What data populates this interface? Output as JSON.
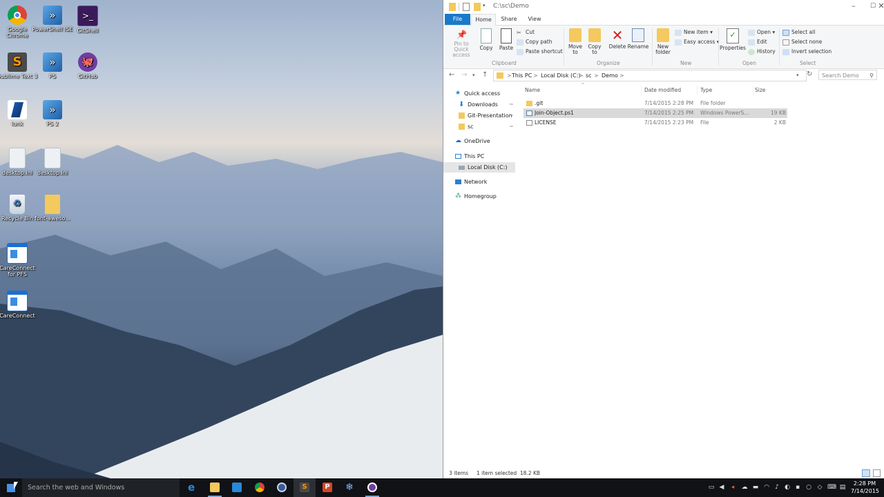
{
  "desktop": {
    "icons": [
      {
        "label": "Google Chrome",
        "icon": "chrome-icon"
      },
      {
        "label": "PowerShell ISE",
        "icon": "powershell-ise-icon"
      },
      {
        "label": "GitShell",
        "icon": "gitshell-icon"
      },
      {
        "label": "Sublime Text 3",
        "icon": "sublime-text-icon"
      },
      {
        "label": "PS",
        "icon": "powershell-icon"
      },
      {
        "label": "GitHub",
        "icon": "github-icon"
      },
      {
        "label": "lunk",
        "icon": "link-icon"
      },
      {
        "label": "PS 2",
        "icon": "powershell-icon"
      },
      {
        "label": "desktop.ini",
        "icon": "ini-file-icon"
      },
      {
        "label": "desktop.ini",
        "icon": "ini-file-icon"
      },
      {
        "label": "Recycle Bin",
        "icon": "recycle-bin-icon"
      },
      {
        "label": "font-aweso...",
        "icon": "folder-icon"
      },
      {
        "label": "CareConnect for PFS",
        "icon": "app-window-icon"
      },
      {
        "label": "CareConnect",
        "icon": "app-window-icon"
      }
    ]
  },
  "explorer": {
    "title": "C:\\sc\\Demo",
    "tabs": {
      "file": "File",
      "home": "Home",
      "share": "Share",
      "view": "View"
    },
    "ribbon": {
      "pin": "Pin to Quick access",
      "copy": "Copy",
      "paste": "Paste",
      "cut": "Cut",
      "copy_path": "Copy path",
      "paste_shortcut": "Paste shortcut",
      "group_clipboard": "Clipboard",
      "move_to": "Move to",
      "copy_to": "Copy to",
      "delete": "Delete",
      "rename": "Rename",
      "group_organize": "Organize",
      "new_folder": "New folder",
      "new_item": "New item",
      "easy_access": "Easy access",
      "group_new": "New",
      "properties": "Properties",
      "open": "Open",
      "edit": "Edit",
      "history": "History",
      "group_open": "Open",
      "select_all": "Select all",
      "select_none": "Select none",
      "invert_selection": "Invert selection",
      "group_select": "Select"
    },
    "address": {
      "parts": [
        "This PC",
        "Local Disk (C:)",
        "sc",
        "Demo"
      ],
      "separator": ">"
    },
    "search_placeholder": "Search Demo",
    "nav": {
      "quick_access": "Quick access",
      "downloads": "Downloads",
      "git_presentation": "Git-Presentation",
      "sc": "sc",
      "onedrive": "OneDrive",
      "this_pc": "This PC",
      "local_disk": "Local Disk (C:)",
      "network": "Network",
      "homegroup": "Homegroup"
    },
    "columns": {
      "name": "Name",
      "date": "Date modified",
      "type": "Type",
      "size": "Size"
    },
    "files": [
      {
        "name": ".git",
        "date": "7/14/2015 2:28 PM",
        "type": "File folder",
        "size": "",
        "icon": "folder-icon"
      },
      {
        "name": "Join-Object.ps1",
        "date": "7/14/2015 2:25 PM",
        "type": "Windows PowerS...",
        "size": "19 KB",
        "icon": "powershell-file-icon"
      },
      {
        "name": "LICENSE",
        "date": "7/14/2015 2:23 PM",
        "type": "File",
        "size": "2 KB",
        "icon": "file-icon"
      }
    ],
    "status": {
      "items": "3 items",
      "selected": "1 item selected  18.2 KB"
    }
  },
  "taskbar": {
    "search_placeholder": "Search the web and Windows",
    "apps": [
      "edge-icon",
      "file-explorer-icon",
      "store-icon",
      "chrome-icon",
      "remote-icon",
      "sublime-text-icon",
      "powerpoint-icon",
      "snowflake-icon",
      "app-circle-icon"
    ],
    "time": "2:28 PM",
    "date": "7/14/2015"
  },
  "colors": {
    "accent": "#1979ca",
    "taskbar": "#101216",
    "selection": "#d9d9d9"
  }
}
